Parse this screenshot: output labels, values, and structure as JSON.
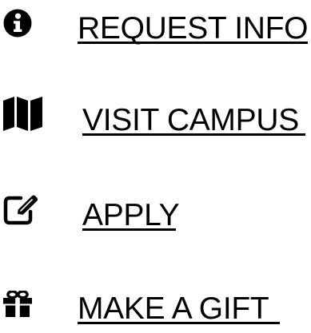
{
  "nav": {
    "items": [
      {
        "label": "REQUEST INFO",
        "icon": "info-circle-icon"
      },
      {
        "label": "VISIT CAMPUS",
        "icon": "map-icon"
      },
      {
        "label": "APPLY",
        "icon": "edit-square-icon"
      },
      {
        "label": "MAKE A GIFT",
        "icon": "gift-icon"
      }
    ]
  },
  "colors": {
    "text": "#000000",
    "background": "#ffffff"
  }
}
